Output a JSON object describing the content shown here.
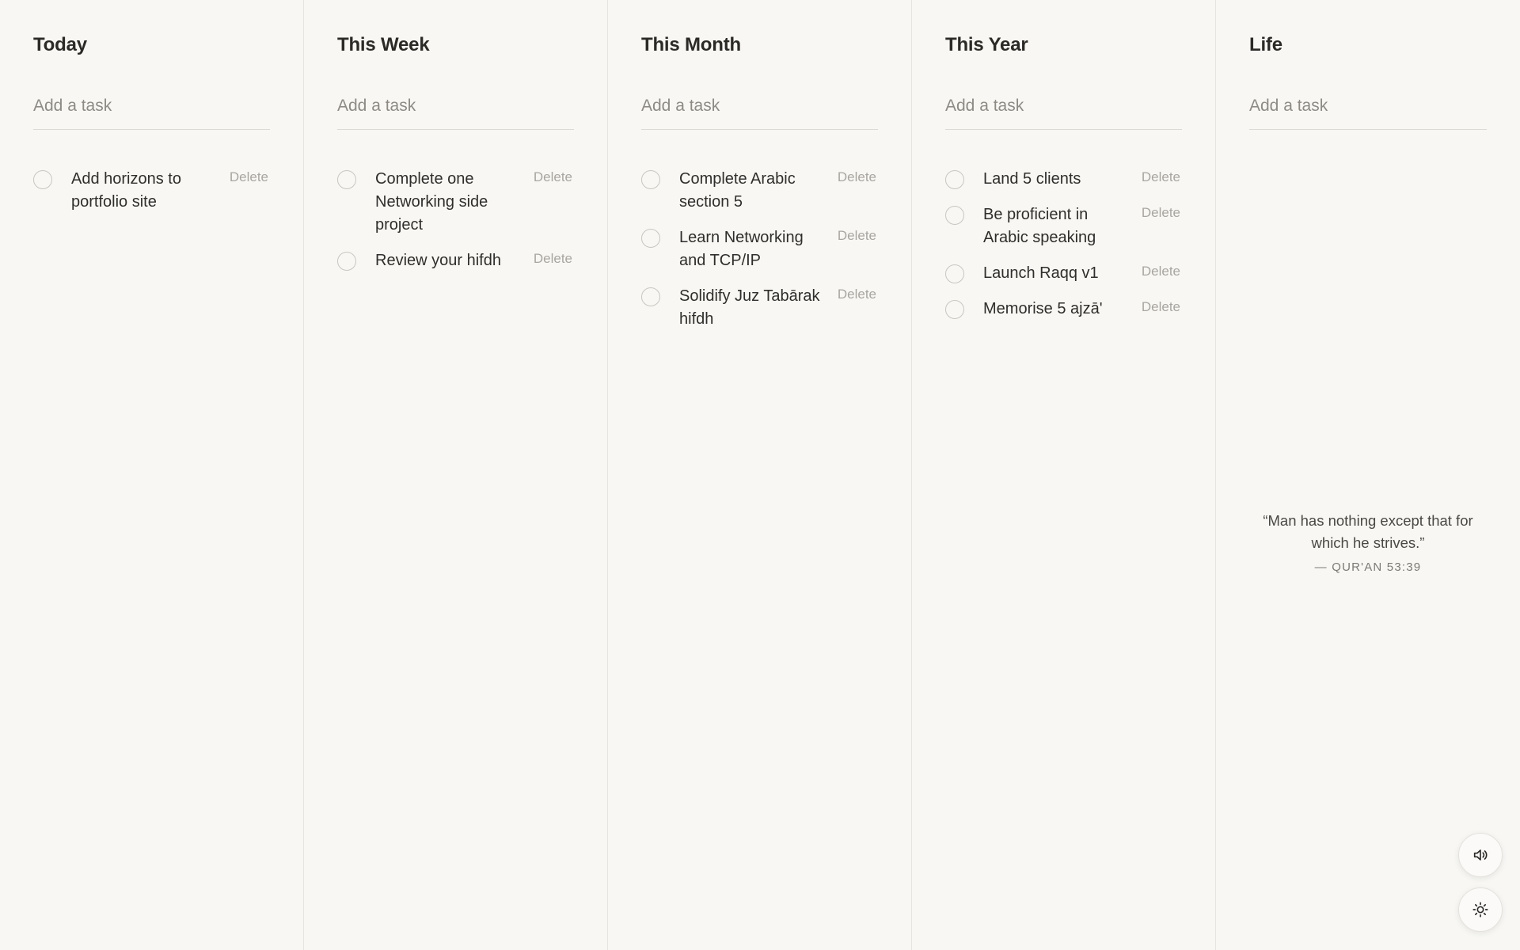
{
  "columns": [
    {
      "title": "Today",
      "placeholder": "Add a task",
      "tasks": [
        {
          "text": "Add horizons to portfolio site",
          "delete_label": "Delete"
        }
      ]
    },
    {
      "title": "This Week",
      "placeholder": "Add a task",
      "tasks": [
        {
          "text": "Complete one Networking side project",
          "delete_label": "Delete"
        },
        {
          "text": "Review your hifdh",
          "delete_label": "Delete"
        }
      ]
    },
    {
      "title": "This Month",
      "placeholder": "Add a task",
      "tasks": [
        {
          "text": "Complete Arabic section 5",
          "delete_label": "Delete"
        },
        {
          "text": "Learn Networking and TCP/IP",
          "delete_label": "Delete"
        },
        {
          "text": "Solidify Juz Tabārak hifdh",
          "delete_label": "Delete"
        }
      ]
    },
    {
      "title": "This Year",
      "placeholder": "Add a task",
      "tasks": [
        {
          "text": "Land 5 clients",
          "delete_label": "Delete"
        },
        {
          "text": "Be proficient in Arabic speaking",
          "delete_label": "Delete"
        },
        {
          "text": "Launch Raqq v1",
          "delete_label": "Delete"
        },
        {
          "text": "Memorise 5 ajzā'",
          "delete_label": "Delete"
        }
      ]
    },
    {
      "title": "Life",
      "placeholder": "Add a task",
      "tasks": []
    }
  ],
  "quote": {
    "text": "“Man has nothing except that for which he strives.”",
    "source": "— QUR'AN 53:39"
  },
  "controls": {
    "sound_icon": "speaker-icon",
    "theme_icon": "sun-icon"
  }
}
